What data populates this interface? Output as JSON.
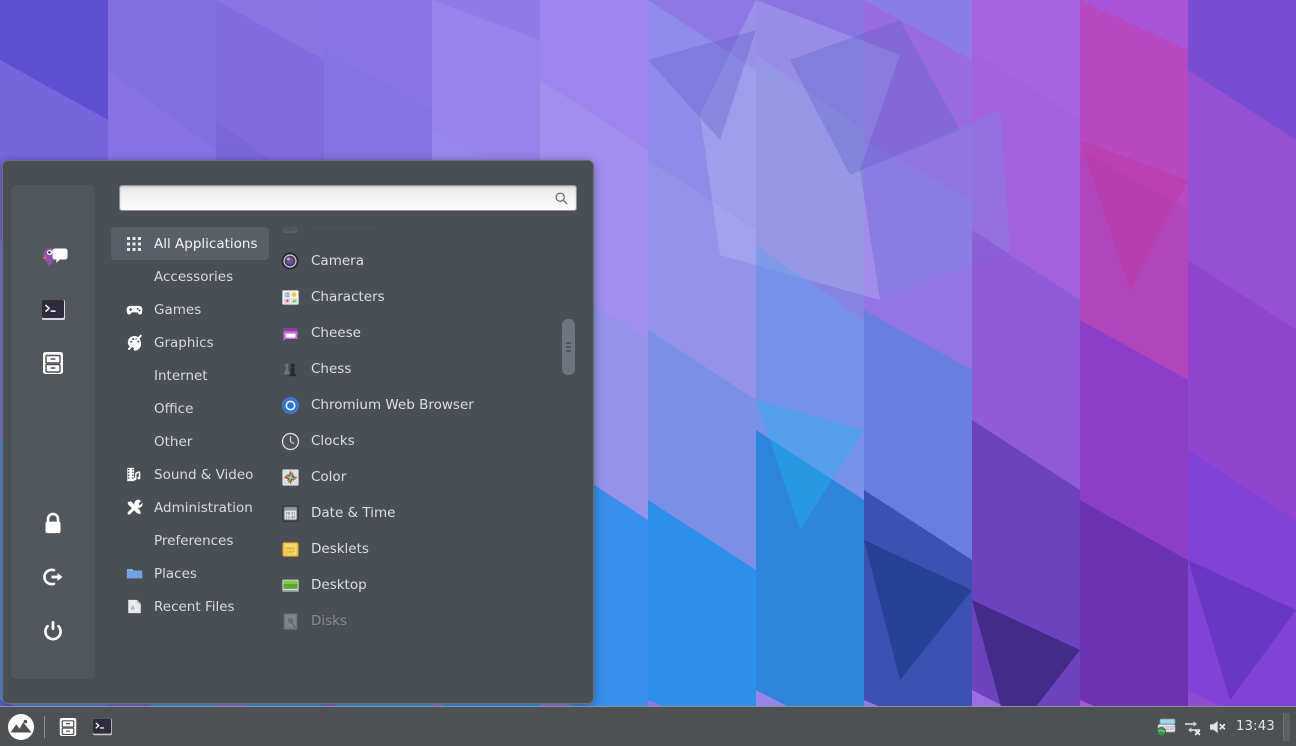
{
  "desktop": {
    "wallpaper_name": "geometric-polygon-wallpaper",
    "palette": [
      "#5a55d6",
      "#7b66e0",
      "#9a7ae8",
      "#a87ce6",
      "#8f6ae0",
      "#c23aa8",
      "#b43a9e",
      "#3f9be0",
      "#2aa6ef",
      "#1f7fd4",
      "#6d9ce8",
      "#8fb4ef",
      "#3b2f8f",
      "#2b2470"
    ]
  },
  "menu": {
    "search": {
      "value": "",
      "placeholder": "",
      "icon": "search-icon"
    },
    "favorites": [
      {
        "name": "pidgin-chat-icon",
        "label": "Pidgin Internet Messenger"
      },
      {
        "name": "terminal-icon",
        "label": "Terminal"
      },
      {
        "name": "files-icon",
        "label": "Files"
      }
    ],
    "system_buttons": [
      {
        "name": "lock-screen-icon",
        "label": "Lock Screen"
      },
      {
        "name": "logout-icon",
        "label": "Log Out"
      },
      {
        "name": "power-icon",
        "label": "Quit"
      }
    ],
    "categories": [
      {
        "label": "All Applications",
        "icon": "grid-icon",
        "selected": true
      },
      {
        "label": "Accessories",
        "icon": "none",
        "selected": false
      },
      {
        "label": "Games",
        "icon": "gamepad-icon",
        "selected": false
      },
      {
        "label": "Graphics",
        "icon": "palette-icon",
        "selected": false
      },
      {
        "label": "Internet",
        "icon": "none",
        "selected": false
      },
      {
        "label": "Office",
        "icon": "none",
        "selected": false
      },
      {
        "label": "Other",
        "icon": "none",
        "selected": false
      },
      {
        "label": "Sound & Video",
        "icon": "film-music-icon",
        "selected": false
      },
      {
        "label": "Administration",
        "icon": "tools-icon",
        "selected": false
      },
      {
        "label": "Preferences",
        "icon": "none",
        "selected": false
      },
      {
        "label": "Places",
        "icon": "folder-icon",
        "selected": false
      },
      {
        "label": "Recent Files",
        "icon": "recent-file-icon",
        "selected": false
      }
    ],
    "applications": [
      {
        "label": "Calculator",
        "icon": "calculator-icon",
        "faded": true
      },
      {
        "label": "Camera",
        "icon": "camera-icon",
        "faded": false
      },
      {
        "label": "Characters",
        "icon": "characters-icon",
        "faded": false
      },
      {
        "label": "Cheese",
        "icon": "cheese-icon",
        "faded": false
      },
      {
        "label": "Chess",
        "icon": "chess-icon",
        "faded": false
      },
      {
        "label": "Chromium Web Browser",
        "icon": "chromium-icon",
        "faded": false
      },
      {
        "label": "Clocks",
        "icon": "clocks-icon",
        "faded": false
      },
      {
        "label": "Color",
        "icon": "color-icon",
        "faded": false
      },
      {
        "label": "Date & Time",
        "icon": "datetime-icon",
        "faded": false
      },
      {
        "label": "Desklets",
        "icon": "desklets-icon",
        "faded": false
      },
      {
        "label": "Desktop",
        "icon": "desktop-icon",
        "faded": false
      },
      {
        "label": "Disks",
        "icon": "disks-icon",
        "faded": true
      }
    ]
  },
  "taskbar": {
    "menu_button": {
      "name": "mint-menu-button",
      "label": "Menu"
    },
    "launchers": [
      {
        "name": "files-launcher",
        "label": "Files"
      },
      {
        "name": "terminal-launcher",
        "label": "Terminal"
      }
    ],
    "tray": [
      {
        "name": "keyboard-layout-icon",
        "label": "Keyboard layout"
      },
      {
        "name": "network-disconnected-icon",
        "label": "Network disconnected"
      },
      {
        "name": "volume-muted-icon",
        "label": "Volume muted"
      }
    ],
    "clock": "13:43",
    "show_desktop": {
      "name": "show-desktop-button",
      "label": "Show desktop"
    }
  }
}
